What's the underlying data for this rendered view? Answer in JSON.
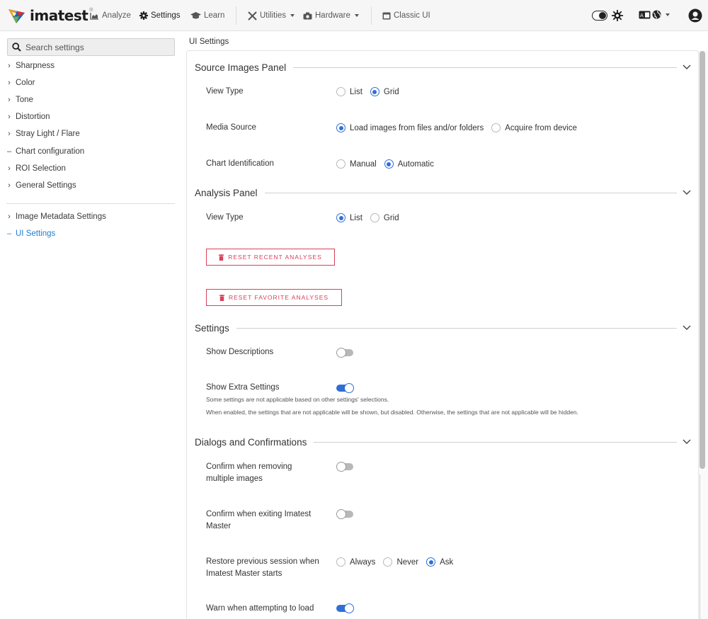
{
  "app": {
    "brand": "imatest",
    "brand_mark": "®"
  },
  "topnav": {
    "analyze": "Analyze",
    "settings": "Settings",
    "learn": "Learn",
    "utilities": "Utilities",
    "hardware": "Hardware",
    "classic_ui": "Classic UI",
    "icons": [
      "chart-icon",
      "gear-icon",
      "graduation-cap-icon",
      "tools-icon",
      "camera-icon",
      "window-icon",
      "theme-toggle-icon",
      "sun-icon",
      "language-icon",
      "globe-icon",
      "user-icon"
    ]
  },
  "sidebar": {
    "search_placeholder": "Search settings",
    "items": [
      {
        "label": "Sharpness",
        "mark": "›"
      },
      {
        "label": "Color",
        "mark": "›"
      },
      {
        "label": "Tone",
        "mark": "›"
      },
      {
        "label": "Distortion",
        "mark": "›"
      },
      {
        "label": "Stray Light / Flare",
        "mark": "›"
      },
      {
        "label": "Chart configuration",
        "mark": "–"
      },
      {
        "label": "ROI Selection",
        "mark": "›"
      },
      {
        "label": "General Settings",
        "mark": "›"
      }
    ],
    "items2": [
      {
        "label": "Image Metadata Settings",
        "mark": "›"
      },
      {
        "label": "UI Settings",
        "mark": "–",
        "selected": true
      }
    ]
  },
  "main": {
    "page_title": "UI Settings",
    "sections": {
      "source_images": {
        "title": "Source Images Panel",
        "view_type": {
          "label": "View Type",
          "options": [
            "List",
            "Grid"
          ],
          "selected": "Grid"
        },
        "media_source": {
          "label": "Media Source",
          "options": [
            "Load images from files and/or folders",
            "Acquire from device"
          ],
          "selected": "Load images from files and/or folders"
        },
        "chart_identification": {
          "label": "Chart Identification",
          "options": [
            "Manual",
            "Automatic"
          ],
          "selected": "Automatic"
        }
      },
      "analysis": {
        "title": "Analysis Panel",
        "view_type": {
          "label": "View Type",
          "options": [
            "List",
            "Grid"
          ],
          "selected": "List"
        },
        "reset_recent": "RESET RECENT ANALYSES",
        "reset_favorite": "RESET FAVORITE ANALYSES"
      },
      "settings": {
        "title": "Settings",
        "show_descriptions": {
          "label": "Show Descriptions",
          "enabled": false
        },
        "show_extra": {
          "label": "Show Extra Settings",
          "enabled": true,
          "note1": "Some settings are not applicable based on other settings' selections.",
          "note2": "When enabled, the settings that are not applicable will be shown, but disabled. Otherwise, the settings that are not applicable will be hidden."
        }
      },
      "dialogs": {
        "title": "Dialogs and Confirmations",
        "confirm_remove": {
          "label_line1": "Confirm when removing",
          "label_line2": "multiple images",
          "enabled": false
        },
        "confirm_exit": {
          "label_line1": "Confirm when exiting Imatest",
          "label_line2": "Master",
          "enabled": false
        },
        "restore_session": {
          "label_line1": "Restore previous session when",
          "label_line2": "Imatest Master starts",
          "options": [
            "Always",
            "Never",
            "Ask"
          ],
          "selected": "Ask"
        },
        "warn_load": {
          "label_line1": "Warn when attempting to load",
          "enabled": true
        }
      }
    }
  },
  "colors": {
    "accent": "#2f6fd6",
    "danger": "#d9405b",
    "selected_nav": "#1c7ed6"
  }
}
